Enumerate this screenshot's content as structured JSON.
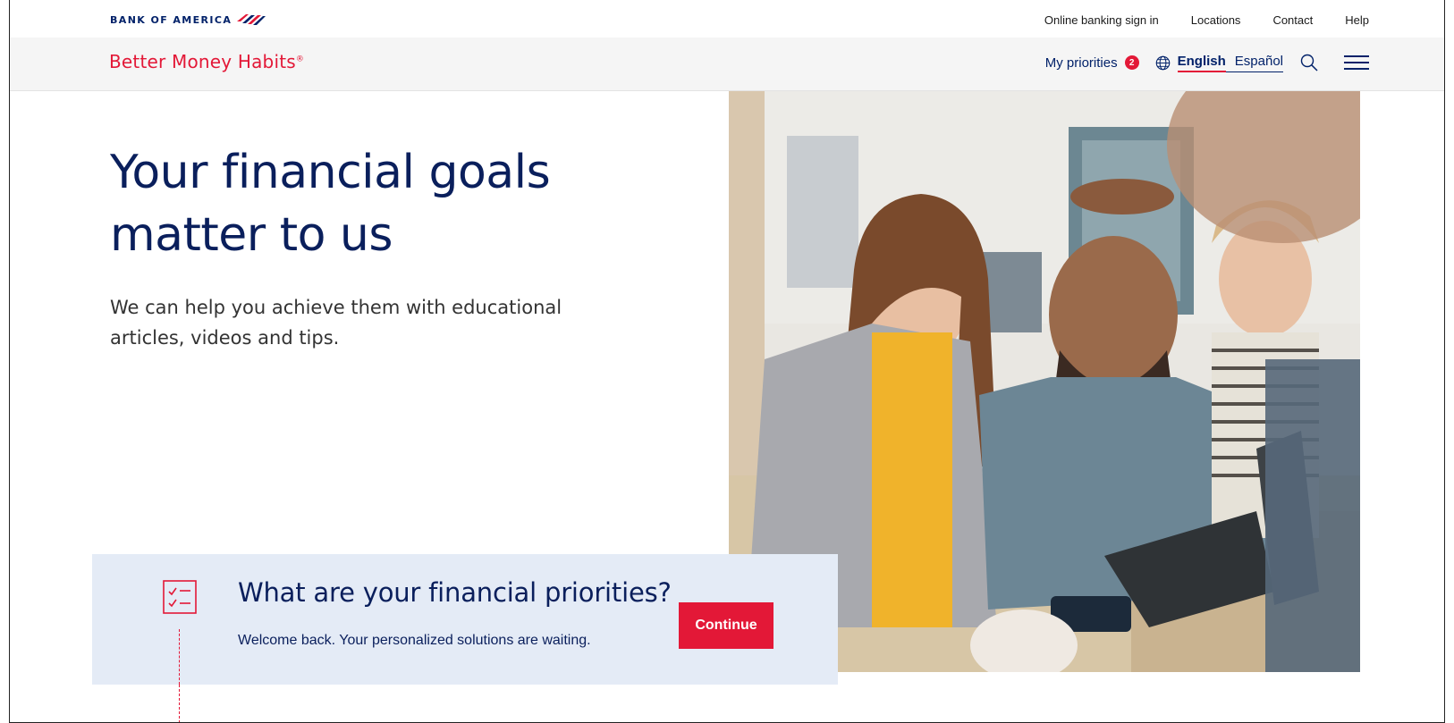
{
  "utility": {
    "brand": "BANK OF AMERICA",
    "links": [
      "Online banking sign in",
      "Locations",
      "Contact",
      "Help"
    ]
  },
  "nav": {
    "brand": "Better Money Habits",
    "brand_mark": "®",
    "priorities_label": "My priorities",
    "priorities_count": "2",
    "lang_english": "English",
    "lang_spanish": "Español"
  },
  "hero": {
    "title_line1": "Your financial goals",
    "title_line2": "matter to us",
    "subtitle": "We can help you achieve them with educational articles, videos and tips."
  },
  "panel": {
    "title": "What are your financial priorities?",
    "text": "Welcome back. Your personalized solutions are waiting.",
    "button": "Continue"
  },
  "colors": {
    "brand_red": "#e31837",
    "navy": "#012169",
    "panel_bg": "#e4ebf6"
  },
  "icons": [
    "boa-flag-icon",
    "globe-icon",
    "search-icon",
    "menu-icon",
    "checklist-icon"
  ]
}
